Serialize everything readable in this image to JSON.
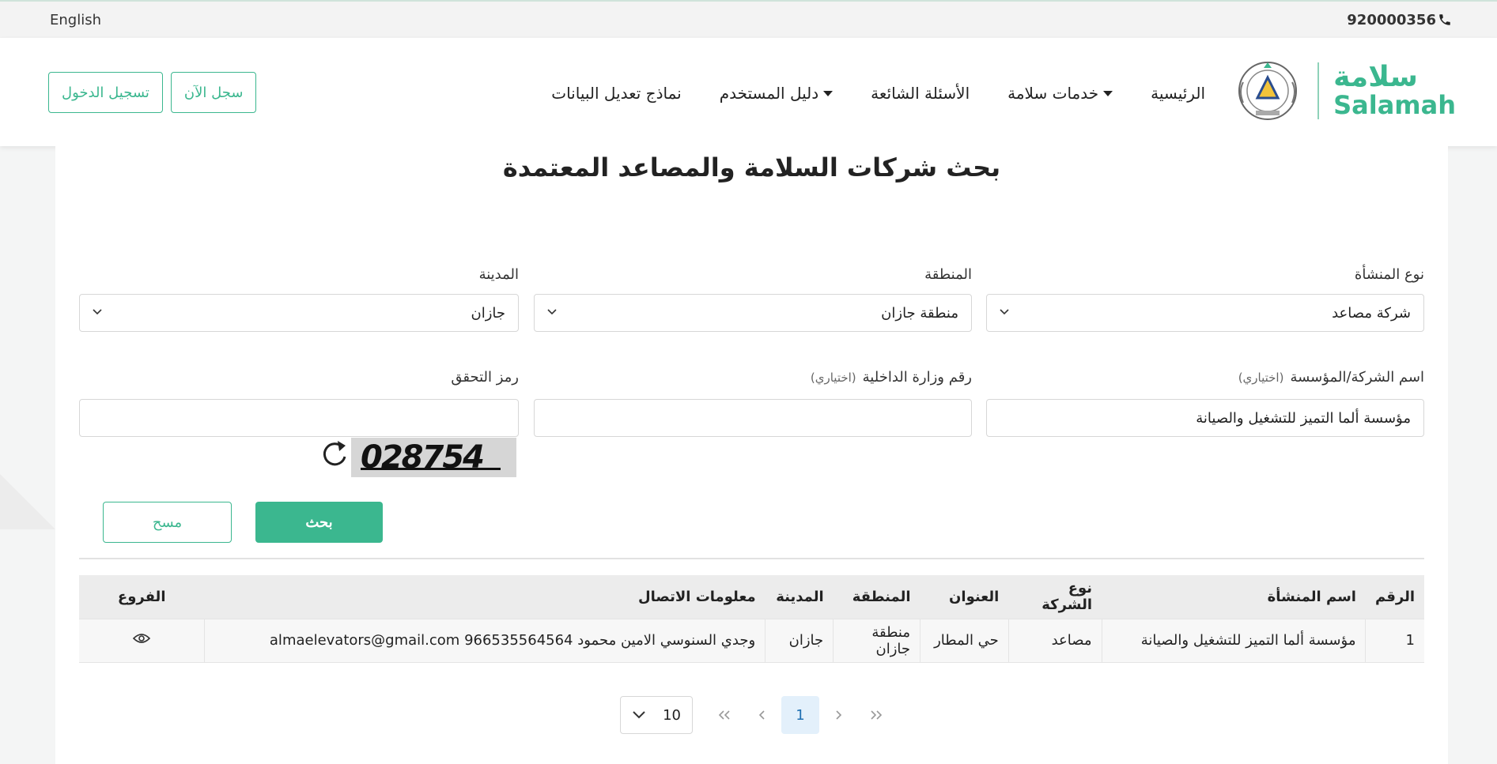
{
  "topbar": {
    "language": "English",
    "phone": "920000356"
  },
  "brand": {
    "name_ar": "سلامة",
    "name_en": "Salamah"
  },
  "nav": {
    "home": "الرئيسية",
    "services": "خدمات سلامة",
    "faq": "الأسئلة الشائعة",
    "guide": "دليل المستخدم",
    "forms": "نماذج تعديل البيانات"
  },
  "auth": {
    "register": "سجل الآن",
    "login": "تسجيل الدخول"
  },
  "page": {
    "title": "بحث شركات السلامة والمصاعد المعتمدة"
  },
  "form": {
    "facility_type_label": "نوع المنشأة",
    "facility_type_value": "شركة مصاعد",
    "region_label": "المنطقة",
    "region_value": "منطقة جازان",
    "city_label": "المدينة",
    "city_value": "جازان",
    "company_name_label": "اسم الشركة/المؤسسة",
    "company_name_optional": "(اختياري)",
    "company_name_value": "مؤسسة ألما التميز للتشغيل والصيانة",
    "moi_number_label": "رقم وزارة الداخلية",
    "moi_number_optional": "(اختياري)",
    "moi_number_value": "",
    "captcha_label": "رمز التحقق",
    "captcha_value": "",
    "captcha_code": "028754",
    "search_button": "بحث",
    "clear_button": "مسح"
  },
  "table": {
    "headers": {
      "num": "الرقم",
      "facility_name": "اسم المنشأة",
      "company_type": "نوع الشركة",
      "address": "العنوان",
      "region": "المنطقة",
      "city": "المدينة",
      "contact": "معلومات الاتصال",
      "branches": "الفروع"
    },
    "rows": [
      {
        "num": "1",
        "facility_name": "مؤسسة ألما التميز للتشغيل والصيانة",
        "company_type": "مصاعد",
        "address": "حي المطار",
        "region": "منطقة جازان",
        "city": "جازان",
        "contact": "وجدي السنوسي الامين محمود 966535564564 almaelevators@gmail.com"
      }
    ]
  },
  "pagination": {
    "page_size": "10",
    "current_page": "1"
  },
  "colors": {
    "accent": "#3bb78f",
    "active_page_bg": "#e3f0fb"
  }
}
